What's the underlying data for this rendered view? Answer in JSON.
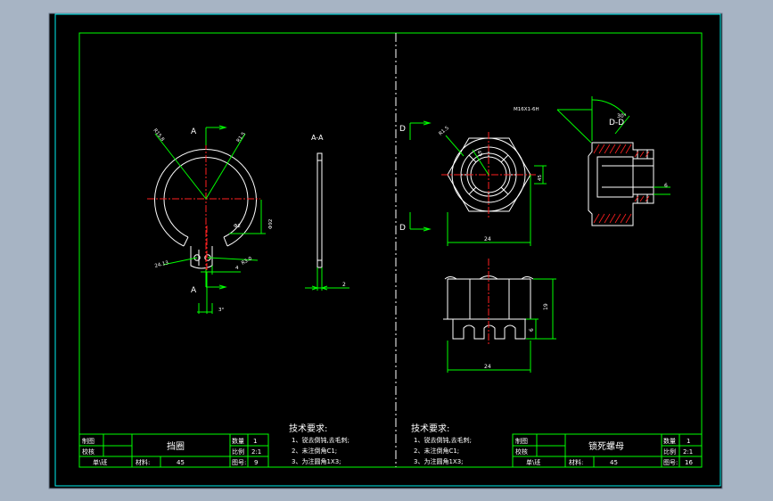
{
  "colors": {
    "background": "#a7b4c4",
    "sheet": "#000000",
    "border": "#00f0f0",
    "frame": "#00ff00",
    "geometry": "#ffffff",
    "center_line": "#ff2020",
    "dimension": "#00ff00",
    "hatch": "#ff2020",
    "text": "#ffffff"
  },
  "left_part": {
    "section_label_top": "A",
    "section_label_bottom": "A",
    "section_view_title": "A-A",
    "dims": {
      "r_outer": "R15.8",
      "r_top": "R1.5",
      "phi_92": "Φ92",
      "phi_2": "Φ2",
      "r_small": "R1.5",
      "r_bottom": "R3.0",
      "d_4": "4",
      "angle_3": "3°",
      "thickness_2": "2",
      "dim_24": "24.13"
    }
  },
  "right_part": {
    "section_label_top": "D",
    "section_label_bottom": "D",
    "section_view_title": "D-D",
    "dims": {
      "thread": "M16X1-6H",
      "angle_30": "30°",
      "r_small": "R1.5",
      "d_45": "45",
      "width_24_top": "24",
      "width_24_bottom": "24",
      "height_19": "19",
      "height_6": "6",
      "slot_6": "6",
      "d_45b": "45"
    }
  },
  "tech_left": {
    "title": "技术要求:",
    "lines": [
      "1、锐去倒钝,去毛刺;",
      "2、未注倒角C1;",
      "3、为注圆角1X3;"
    ]
  },
  "tech_right": {
    "title": "技术要求:",
    "lines": [
      "1、锐去倒钝,去毛刺;",
      "2、未注倒角C1;",
      "3、为注圆角1X3;"
    ]
  },
  "title_block_left": {
    "drawn_label": "制图",
    "checked_label": "校核",
    "org_label": "单\\班",
    "part_name": "挡圈",
    "qty_label": "数量",
    "qty_value": "1",
    "scale_label": "比例",
    "scale_value": "2:1",
    "material_label": "材料:",
    "material_value": "45",
    "drawing_no_label": "图号:",
    "drawing_no_value": "9"
  },
  "title_block_right": {
    "drawn_label": "制图",
    "checked_label": "校核",
    "org_label": "单\\班",
    "part_name": "锁死螺母",
    "qty_label": "数量",
    "qty_value": "1",
    "scale_label": "比例",
    "scale_value": "2:1",
    "material_label": "材料:",
    "material_value": "45",
    "drawing_no_label": "图号:",
    "drawing_no_value": "16"
  }
}
